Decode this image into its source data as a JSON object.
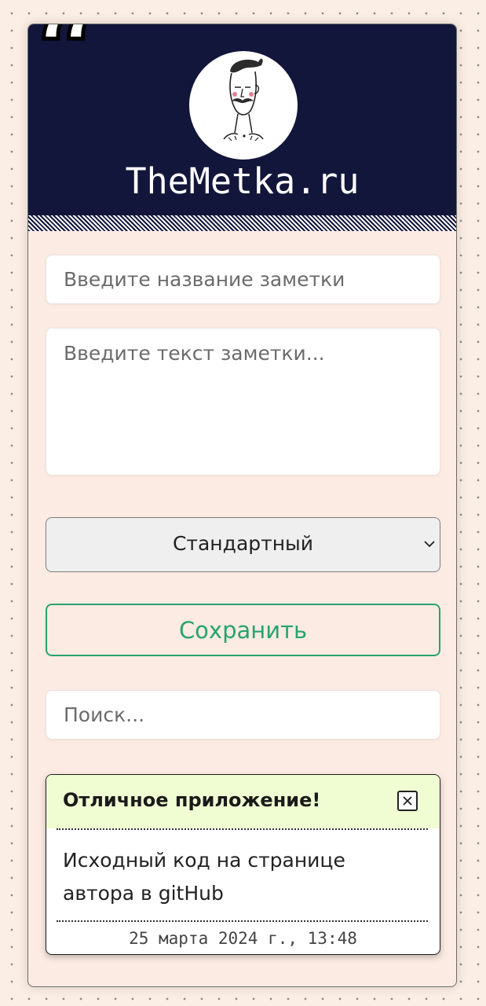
{
  "header": {
    "site_name": "TheMetka.ru",
    "avatar_icon": "mustached-man-portrait-icon",
    "quote_icon": "quote-mark-icon",
    "quote_glyph": "“",
    "background_color": "#12163a"
  },
  "form": {
    "title_placeholder": "Введите название заметки",
    "text_placeholder": "Введите текст заметки...",
    "category_selected": "Стандартный",
    "save_label": "Сохранить",
    "save_color": "#26a36f"
  },
  "search": {
    "placeholder": "Поиск..."
  },
  "notes": [
    {
      "title": "Отличное приложение!",
      "body": "Исходный код на странице автора в gitHub",
      "timestamp": "25 марта 2024 г., 13:48",
      "header_color": "#f0fdd2"
    }
  ]
}
